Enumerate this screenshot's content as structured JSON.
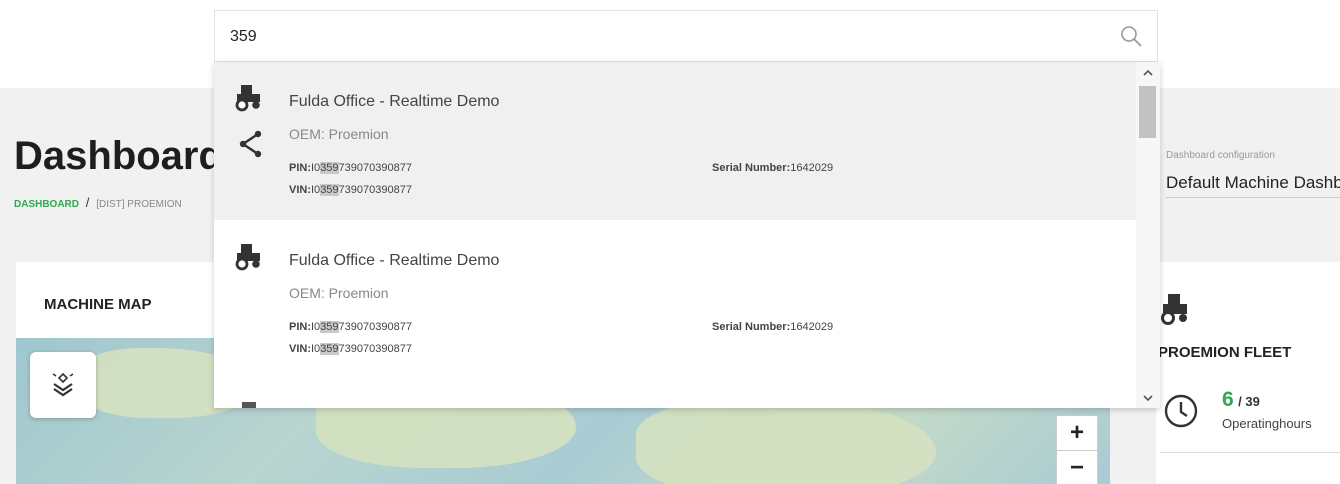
{
  "search": {
    "value": "359"
  },
  "page": {
    "title": "Dashboard",
    "breadcrumb": [
      "DASHBOARD",
      "/",
      "[DIST] PROEMION"
    ],
    "dashboard_config_label": "Dashboard configuration",
    "dashboard_config_value": "Default Machine Dashboard"
  },
  "map": {
    "title": "MACHINE MAP",
    "zoom_in": "+",
    "zoom_out": "−"
  },
  "fleet": {
    "title": "PROEMION FLEET",
    "stat_value": "6",
    "stat_total": "/ 39",
    "stat_label": "Operatinghours"
  },
  "results": [
    {
      "name": "Fulda Office - Realtime Demo",
      "oem": "OEM: Proemion",
      "pin_label": "PIN:",
      "pin_pre": "I0",
      "pin_match": "359",
      "pin_post": "739070390877",
      "vin_label": "VIN:",
      "vin_pre": "I0",
      "vin_match": "359",
      "vin_post": "739070390877",
      "serial_label": "Serial Number:",
      "serial_value": "1642029",
      "icon": "tractor-icon",
      "shared": true
    },
    {
      "name": "Fulda Office - Realtime Demo",
      "oem": "OEM: Proemion",
      "pin_label": "PIN:",
      "pin_pre": "I0",
      "pin_match": "359",
      "pin_post": "739070390877",
      "vin_label": "VIN:",
      "vin_pre": "I0",
      "vin_match": "359",
      "vin_post": "739070390877",
      "serial_label": "Serial Number:",
      "serial_value": "1642029",
      "icon": "tractor-icon",
      "shared": false
    }
  ],
  "colors": {
    "accent_green": "#2fa84f",
    "active_row": "#f0f0f0",
    "match_highlight": "#c9c9c9"
  }
}
